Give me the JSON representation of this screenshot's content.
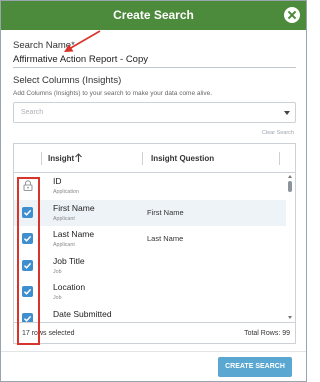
{
  "dialog": {
    "title": "Create Search",
    "close_icon": "close-icon",
    "header_color": "#4c8a3c"
  },
  "form": {
    "search_name_label": "Search Name*",
    "search_name_value": "Affirmative Action Report - Copy",
    "select_columns_title": "Select Columns (Insights)",
    "select_columns_hint": "Add Columns (Insights) to your search to make your data come alive.",
    "search_placeholder": "Search",
    "clear_search": "Clear Search"
  },
  "grid": {
    "headers": {
      "insight": "Insight",
      "question": "Insight Question"
    },
    "rows": [
      {
        "title": "ID",
        "category": "Application",
        "question": "",
        "selected": false,
        "locked": true
      },
      {
        "title": "First Name",
        "category": "Applicant",
        "question": "First Name",
        "selected": true,
        "locked": false
      },
      {
        "title": "Last Name",
        "category": "Applicant",
        "question": "Last Name",
        "selected": true,
        "locked": false
      },
      {
        "title": "Job Title",
        "category": "Job",
        "question": "",
        "selected": true,
        "locked": false
      },
      {
        "title": "Location",
        "category": "Job",
        "question": "",
        "selected": true,
        "locked": false
      },
      {
        "title": "Date Submitted",
        "category": "",
        "question": "",
        "selected": true,
        "locked": false
      }
    ],
    "rows_selected": "17 rows selected",
    "total_rows": "Total Rows: 99"
  },
  "footer": {
    "create_button": "CREATE SEARCH",
    "button_color": "#5aa7d2"
  },
  "annotations": {
    "highlight_color": "#d9342b"
  }
}
